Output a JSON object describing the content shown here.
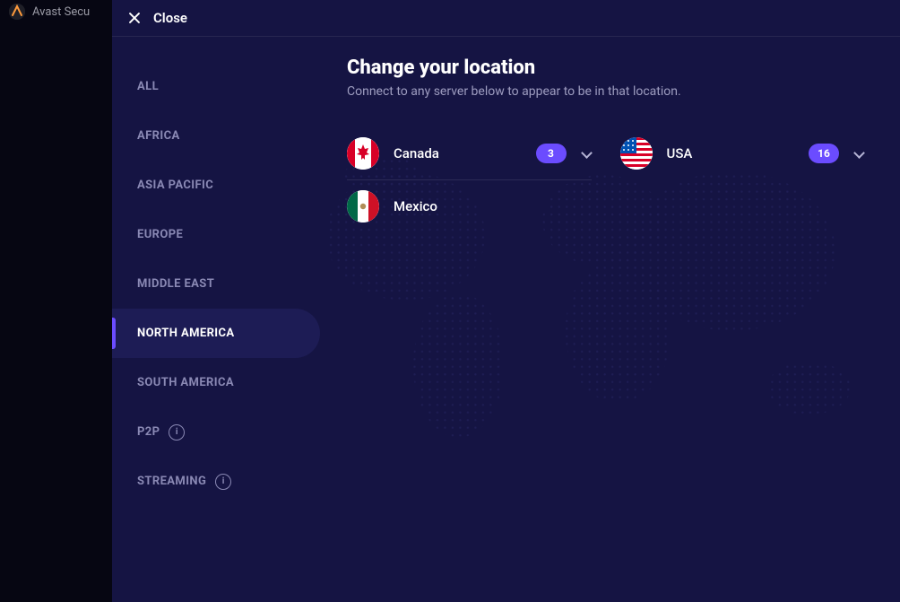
{
  "app": {
    "title": "Avast Secu"
  },
  "header": {
    "close_label": "Close"
  },
  "sidebar": {
    "items": [
      {
        "label": "ALL",
        "active": false,
        "info": false
      },
      {
        "label": "AFRICA",
        "active": false,
        "info": false
      },
      {
        "label": "ASIA PACIFIC",
        "active": false,
        "info": false
      },
      {
        "label": "EUROPE",
        "active": false,
        "info": false
      },
      {
        "label": "MIDDLE EAST",
        "active": false,
        "info": false
      },
      {
        "label": "NORTH AMERICA",
        "active": true,
        "info": false
      },
      {
        "label": "SOUTH AMERICA",
        "active": false,
        "info": false
      },
      {
        "label": "P2P",
        "active": false,
        "info": true
      },
      {
        "label": "STREAMING",
        "active": false,
        "info": true
      }
    ]
  },
  "main": {
    "title": "Change your location",
    "subtitle": "Connect to any server below to appear to be in that location.",
    "locations": [
      {
        "name": "Canada",
        "count": 3,
        "flag": "canada",
        "expandable": true
      },
      {
        "name": "USA",
        "count": 16,
        "flag": "usa",
        "expandable": true
      },
      {
        "name": "Mexico",
        "count": null,
        "flag": "mexico",
        "expandable": false
      }
    ]
  },
  "colors": {
    "accent": "#6b4cff",
    "panel": "#151443"
  }
}
